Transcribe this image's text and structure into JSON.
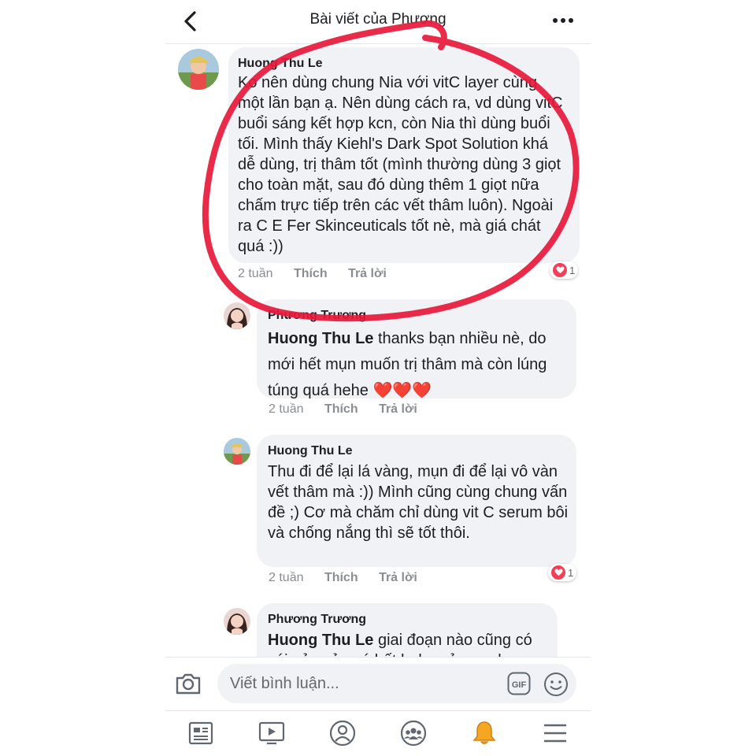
{
  "header": {
    "title": "Bài viết của Phương"
  },
  "comments": [
    {
      "author": "Huong Thu Le",
      "text": "Ko nên dùng chung Nia với vitC layer cùng một lần bạn ạ. Nên dùng cách ra, vd dùng vitC buổi sáng kết hợp kcn, còn Nia thì dùng buổi tối. Mình thấy Kiehl's Dark Spot Solution khá dễ dùng, trị thâm tốt (mình thường dùng 3 giọt cho toàn mặt, sau đó dùng thêm 1 giọt nữa chấm trực tiếp trên các vết thâm luôn). Ngoài ra C E Fer Skinceuticals tốt nè, mà giá chát quá :))",
      "time": "2 tuần",
      "like": "Thích",
      "reply": "Trả lời",
      "reactions": "1"
    },
    {
      "author": "Phương Trương",
      "mention": "Huong Thu Le",
      "text": "thanks bạn nhiều nè, do mới hết mụn muốn trị thâm mà còn lúng túng quá hehe ❤️❤️❤️",
      "time": "2 tuần",
      "like": "Thích",
      "reply": "Trả lời"
    },
    {
      "author": "Huong Thu Le",
      "text": "Thu đi để lại lá vàng, mụn đi để lại vô vàn vết thâm mà :)) Mình cũng cùng chung vấn đề ;) Cơ mà chăm chỉ dùng vit C serum bôi và chống nắng thì sẽ tốt thôi.",
      "time": "2 tuần",
      "like": "Thích",
      "reply": "Trả lời",
      "reactions": "1"
    },
    {
      "author": "Phương Trương",
      "mention": "Huong Thu Le",
      "text": "giai đoạn nào cũng có cái nản của nó hết hehe cảm ơn bạn"
    }
  ],
  "composer": {
    "placeholder": "Viết bình luận...",
    "gif_label": "GIF"
  },
  "colors": {
    "annotation_red": "#e8183a",
    "reaction_red": "#f33e58",
    "bubble": "#f0f2f5"
  },
  "icons": [
    "back-arrow-icon",
    "more-icon",
    "camera-icon",
    "gif-icon",
    "emoji-icon",
    "news-feed-icon",
    "watch-icon",
    "profile-icon",
    "groups-icon",
    "notifications-bell-icon",
    "menu-icon"
  ]
}
